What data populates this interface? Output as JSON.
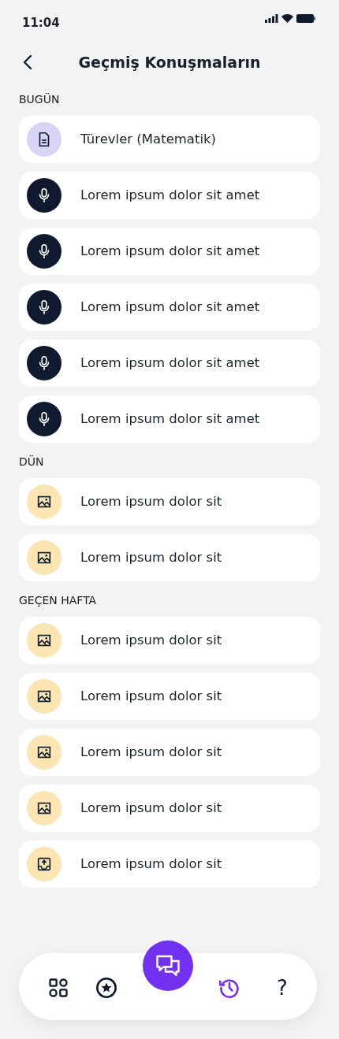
{
  "status_bar": {
    "time": "11:04"
  },
  "header": {
    "title": "Geçmiş Konuşmaların"
  },
  "sections": [
    {
      "title": "BUGÜN",
      "items": [
        {
          "kind": "document",
          "label": "Türevler (Matematik)"
        },
        {
          "kind": "voice",
          "label": "Lorem ipsum dolor sit amet"
        },
        {
          "kind": "voice",
          "label": "Lorem ipsum dolor sit amet"
        },
        {
          "kind": "voice",
          "label": "Lorem ipsum dolor sit amet"
        },
        {
          "kind": "voice",
          "label": "Lorem ipsum dolor sit amet"
        },
        {
          "kind": "voice",
          "label": "Lorem ipsum dolor sit amet"
        }
      ]
    },
    {
      "title": "DÜN",
      "items": [
        {
          "kind": "image",
          "label": "Lorem ipsum dolor sit"
        },
        {
          "kind": "image",
          "label": "Lorem ipsum dolor sit"
        }
      ]
    },
    {
      "title": "GEÇEN HAFTA",
      "items": [
        {
          "kind": "image",
          "label": "Lorem ipsum dolor sit"
        },
        {
          "kind": "image",
          "label": "Lorem ipsum dolor sit"
        },
        {
          "kind": "image",
          "label": "Lorem ipsum dolor sit"
        },
        {
          "kind": "image",
          "label": "Lorem ipsum dolor sit"
        },
        {
          "kind": "upload",
          "label": "Lorem ipsum dolor sit"
        }
      ]
    }
  ],
  "bottom_nav": [
    {
      "kind": "grid",
      "selected": false
    },
    {
      "kind": "favorites",
      "selected": false
    },
    {
      "kind": "chat",
      "selected": false
    },
    {
      "kind": "history",
      "selected": true
    },
    {
      "kind": "help",
      "label": "?",
      "selected": false
    }
  ]
}
